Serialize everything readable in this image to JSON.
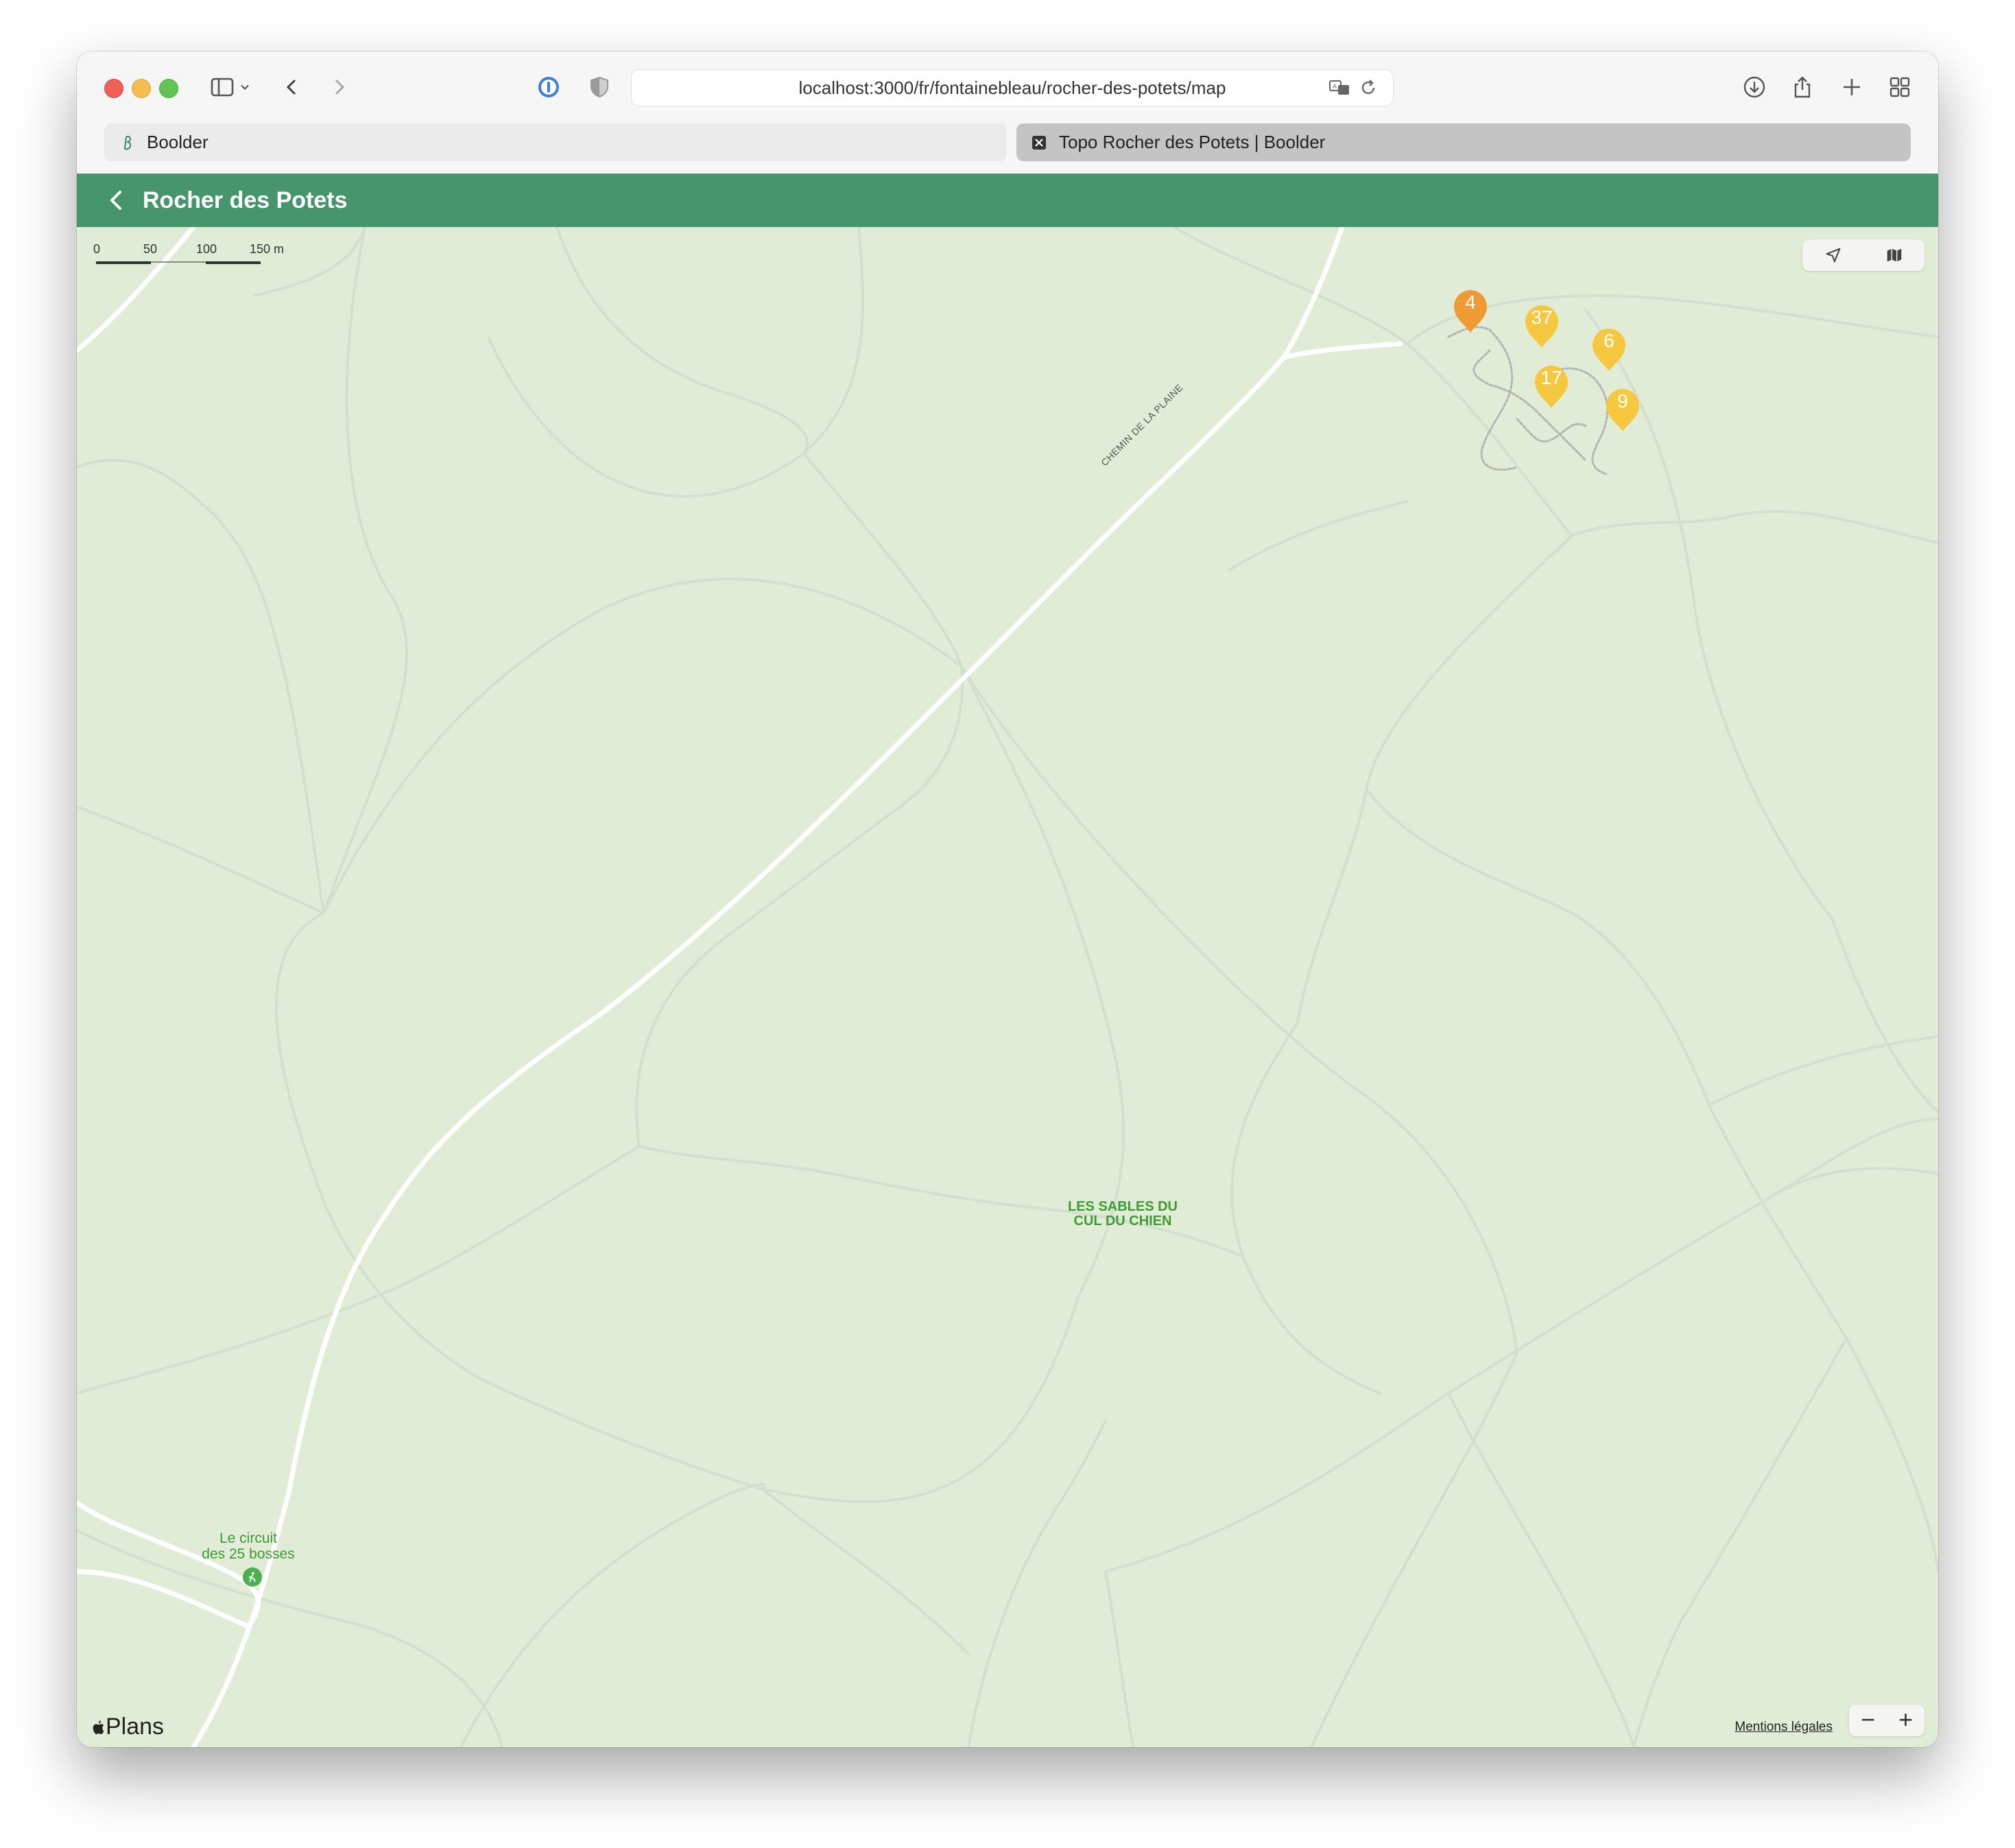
{
  "browser": {
    "url": "localhost:3000/fr/fontainebleau/rocher-des-potets/map",
    "tabs": [
      {
        "label": "Boolder",
        "active": false
      },
      {
        "label": "Topo Rocher des Potets | Boolder",
        "active": true
      }
    ]
  },
  "header": {
    "title": "Rocher des Potets"
  },
  "map": {
    "scale": {
      "labels": [
        "0",
        "50",
        "100",
        "150 m"
      ]
    },
    "area_label": "LES SABLES DU\nCUL DU CHIEN",
    "trail_label": "Le circuit\ndes 25 bosses",
    "road_label": "CHEMIN DE LA PLAINE",
    "attribution": "Plans",
    "legal": "Mentions légales",
    "zoom_out": "−",
    "zoom_in": "+",
    "markers": [
      {
        "count": "4",
        "color": "#ef9a34"
      },
      {
        "count": "37",
        "color": "#f6c83f"
      },
      {
        "count": "6",
        "color": "#f6c83f"
      },
      {
        "count": "17",
        "color": "#f6c83f"
      },
      {
        "count": "9",
        "color": "#f6c83f"
      }
    ]
  },
  "colors": {
    "header_bg": "#46956c",
    "map_bg": "#e0ecd6",
    "label_green": "#3e9a35"
  }
}
